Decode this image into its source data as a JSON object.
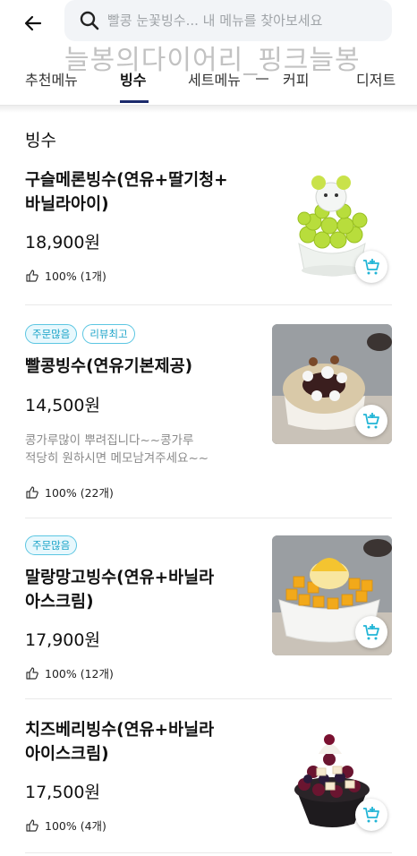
{
  "header": {
    "back_icon": "back-arrow-icon",
    "search_icon": "search-icon",
    "search_placeholder": "빨콩 눈꽃빙수... 내 메뉴를 찾아보세요"
  },
  "watermark": "늘봉의다이어리_핑크늘봉",
  "tabs": [
    {
      "label": "추천메뉴",
      "active": false
    },
    {
      "label": "빙수",
      "active": true
    },
    {
      "label": "세트메뉴",
      "active": false
    },
    {
      "label": "커피",
      "active": false
    },
    {
      "label": "디저트",
      "active": false
    }
  ],
  "section": {
    "title": "빙수"
  },
  "items": [
    {
      "name": "구슬메론빙수(연유+딸기청+\n바닐라아이)",
      "price": "18,900원",
      "badges": [],
      "description": "",
      "rating": "100% (1개)",
      "image": "melon-bingsu-photo"
    },
    {
      "name": "빨콩빙수(연유기본제공)",
      "price": "14,500원",
      "badges": [
        "주문많음",
        "리뷰최고"
      ],
      "description": "콩가루많이 뿌려집니다~~콩가루\n적당히 원하시면 메모남겨주세요~~",
      "rating": "100% (22개)",
      "image": "red-bean-bingsu-photo"
    },
    {
      "name": "말랑망고빙수(연유+바닐라\n아스크림)",
      "price": "17,900원",
      "badges": [
        "주문많음"
      ],
      "description": "",
      "rating": "100% (12개)",
      "image": "mango-bingsu-photo"
    },
    {
      "name": "치즈베리빙수(연유+바닐라\n아이스크림)",
      "price": "17,500원",
      "badges": [],
      "description": "",
      "rating": "100% (4개)",
      "image": "cheese-berry-bingsu-photo"
    }
  ],
  "colors": {
    "badge_text": "#1aa3c8",
    "badge_border": "#5cc6e2",
    "tab_underline": "#1b2a6b",
    "cart_icon": "#22b5d6"
  }
}
